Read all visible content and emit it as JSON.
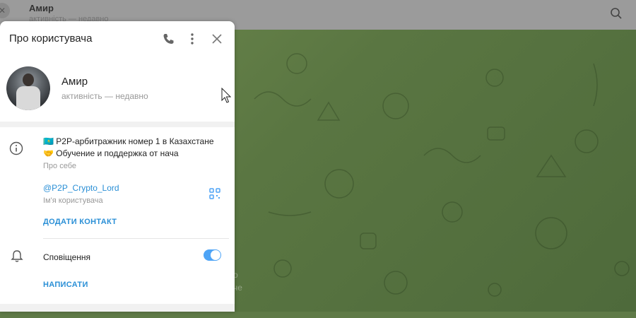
{
  "chat_header": {
    "name": "Амир",
    "status": "активність — недавно",
    "back_icon": "close-icon",
    "search_icon": "search-icon"
  },
  "background_chat": {
    "ghost_text_1": "о",
    "ghost_text_2": "че"
  },
  "panel": {
    "title": "Про користувача",
    "call_icon": "phone-icon",
    "more_icon": "more-vertical-icon",
    "close_icon": "close-icon",
    "user": {
      "name": "Амир",
      "status": "активність — недавно"
    },
    "bio": {
      "line1": "🇰🇿 P2P-арбитражник номер 1 в Казахстане",
      "line2": "🤝 Обучение и поддержка от нача",
      "label": "Про себе"
    },
    "username": {
      "value": "@P2P_Crypto_Lord",
      "label": "Ім'я користувача"
    },
    "add_contact_label": "ДОДАТИ КОНТАКТ",
    "notifications": {
      "label": "Сповіщення",
      "enabled": true
    },
    "write_label": "НАПИСАТИ"
  },
  "colors": {
    "accent": "#2a8fd6",
    "toggle_on": "#4ea4f6",
    "chat_bg": "#5f7a47"
  }
}
